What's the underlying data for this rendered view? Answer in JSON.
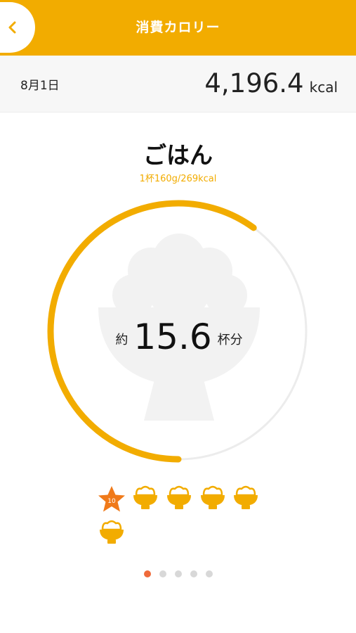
{
  "header": {
    "title": "消費カロリー",
    "back_icon": "chevron-left-icon"
  },
  "summary": {
    "date": "8月1日",
    "calories_value": "4,196.4",
    "calories_unit": "kcal"
  },
  "food": {
    "name": "ごはん",
    "serving": "1杯160g/269kcal"
  },
  "result": {
    "prefix": "約",
    "value": "15.6",
    "suffix": "杯分",
    "progress_fraction": 0.6
  },
  "bowls": {
    "star_count_label": "10",
    "bowl_icons": 5
  },
  "pager": {
    "total": 5,
    "active_index": 0
  },
  "colors": {
    "accent": "#f2ac00",
    "star": "#f07a1a",
    "active_dot": "#ef6a3a"
  }
}
